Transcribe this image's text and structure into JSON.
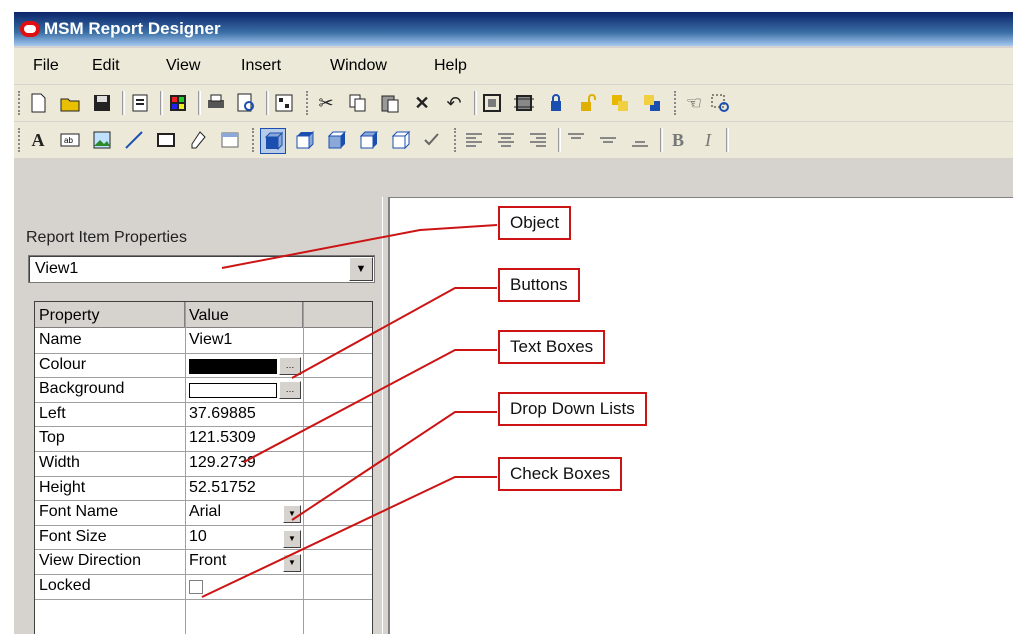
{
  "window": {
    "title": "MSM Report Designer"
  },
  "menu": [
    "File",
    "Edit",
    "View",
    "Insert",
    "Window",
    "Help"
  ],
  "panel": {
    "title": "Report Item Properties",
    "object_selected": "View1",
    "grid_headers": [
      "Property",
      "Value"
    ],
    "rows": [
      {
        "name": "Name",
        "value": "View1",
        "kind": "text"
      },
      {
        "name": "Colour",
        "value": "",
        "kind": "color",
        "color": "#000000"
      },
      {
        "name": "Background",
        "value": "",
        "kind": "color",
        "color": "#ffffff"
      },
      {
        "name": "Left",
        "value": "37.69885",
        "kind": "text"
      },
      {
        "name": "Top",
        "value": "121.5309",
        "kind": "text"
      },
      {
        "name": "Width",
        "value": "129.2739",
        "kind": "text"
      },
      {
        "name": "Height",
        "value": "52.51752",
        "kind": "text"
      },
      {
        "name": "Font Name",
        "value": "Arial",
        "kind": "dropdown"
      },
      {
        "name": "Font Size",
        "value": "10",
        "kind": "dropdown"
      },
      {
        "name": "View Direction",
        "value": "Front",
        "kind": "dropdown"
      },
      {
        "name": "Locked",
        "value": "",
        "kind": "checkbox"
      }
    ]
  },
  "callouts": [
    "Object",
    "Buttons",
    "Text Boxes",
    "Drop Down Lists",
    "Check Boxes"
  ],
  "colors": {
    "accent": "#cc1414",
    "title_bar": "#0a246a"
  }
}
